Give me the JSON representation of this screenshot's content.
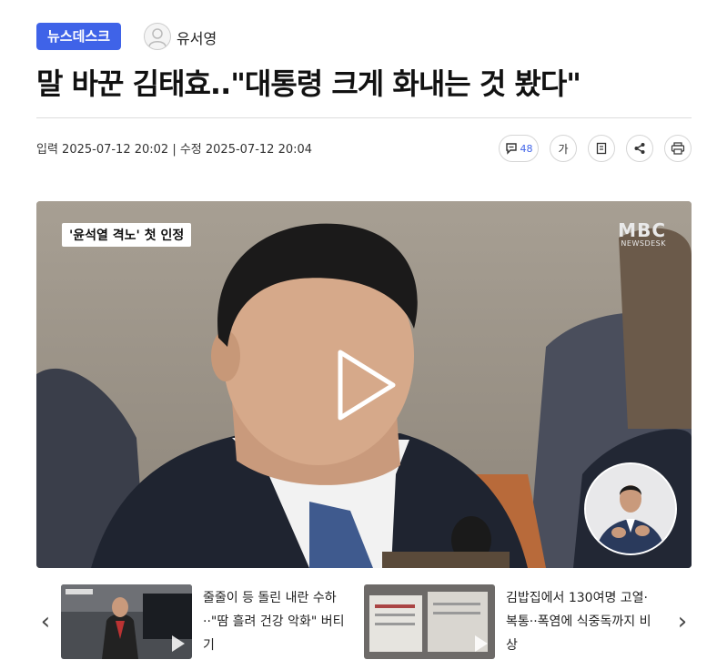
{
  "header": {
    "section_badge": "뉴스데스크",
    "author": "유서영"
  },
  "headline": "말 바꾼 김태효..\"대통령 크게 화내는 것 봤다\"",
  "dates": "입력 2025-07-12 20:02 | 수정 2025-07-12 20:04",
  "tools": {
    "comment_count": "48",
    "font_size_label": "가",
    "icons": [
      "comment-icon",
      "font-size-icon",
      "reader-icon",
      "share-icon",
      "print-icon"
    ]
  },
  "video": {
    "caption": "'윤석열 격노' 첫 인정",
    "logo_main": "MBC",
    "logo_sub": "NEWSDESK"
  },
  "related": [
    {
      "title": "줄줄이 등 돌린 내란 수하··\"땀 흘려 건강 악화\" 버티기"
    },
    {
      "title": "김밥집에서 130여명 고열·복통··폭염에 식중독까지 비상"
    }
  ],
  "colors": {
    "accent": "#3f63e8"
  }
}
